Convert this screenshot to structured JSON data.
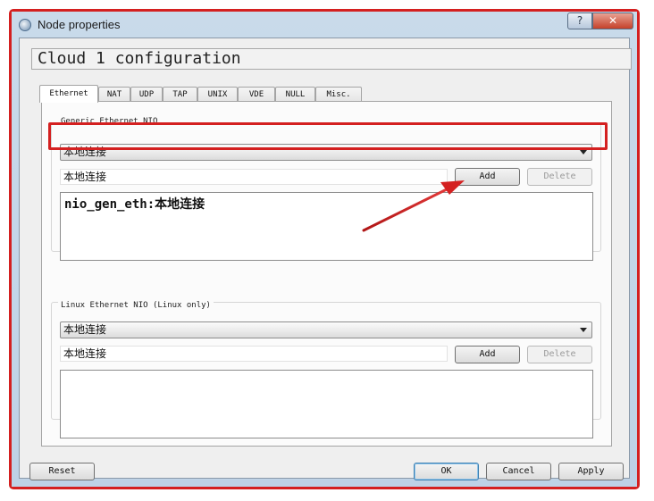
{
  "window": {
    "title": "Node properties",
    "help_label": "?",
    "close_label": "✕"
  },
  "heading": "Cloud 1 configuration",
  "tabs": [
    {
      "label": "Ethernet",
      "active": true
    },
    {
      "label": "NAT"
    },
    {
      "label": "UDP"
    },
    {
      "label": "TAP"
    },
    {
      "label": "UNIX"
    },
    {
      "label": "VDE"
    },
    {
      "label": "NULL"
    },
    {
      "label": "Misc."
    }
  ],
  "generic_nio": {
    "title": "Generic Ethernet NIO",
    "selected": "本地连接",
    "input_value": "本地连接",
    "add_label": "Add",
    "delete_label": "Delete",
    "items": [
      "nio_gen_eth:本地连接"
    ]
  },
  "linux_nio": {
    "title": "Linux Ethernet NIO (Linux only)",
    "selected": "本地连接",
    "input_value": "本地连接",
    "add_label": "Add",
    "delete_label": "Delete",
    "items": []
  },
  "footer": {
    "reset_label": "Reset",
    "ok_label": "OK",
    "cancel_label": "Cancel",
    "apply_label": "Apply"
  },
  "colors": {
    "annotation": "#d42020"
  }
}
